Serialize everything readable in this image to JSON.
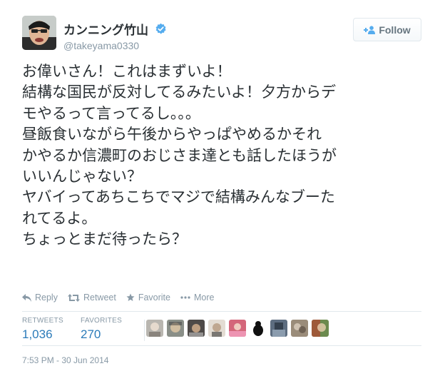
{
  "user": {
    "display_name": "カンニング竹山",
    "handle": "@takeyama0330",
    "verified": true
  },
  "follow_button": {
    "label": "Follow"
  },
  "tweet": {
    "lines": [
      "お偉いさん！これはまずいよ！",
      "結構な国民が反対してるみたいよ！夕方からデ",
      "モやるって言ってるし。。。",
      "昼飯食いながら午後からやっぱやめるかそれ",
      "かやるか信濃町のおじさま達とも話したほうが",
      "いいんじゃない？",
      "ヤバイってあちこちでマジで結構みんなブーた",
      "れてるよ。",
      "ちょっとまだ待ったら？"
    ]
  },
  "actions": {
    "reply": "Reply",
    "retweet": "Retweet",
    "favorite": "Favorite",
    "more": "More"
  },
  "stats": {
    "retweets_label": "RETWEETS",
    "retweets_value": "1,036",
    "favorites_label": "FAVORITES",
    "favorites_value": "270"
  },
  "favoriter_avatars": [
    {
      "color": "#b9b6b0"
    },
    {
      "color": "#8a8f88"
    },
    {
      "color": "#4e4a48"
    },
    {
      "color": "#e3dcd3"
    },
    {
      "color": "#d4667a"
    },
    {
      "color": "#1d1d1d"
    },
    {
      "color": "#5d6d80"
    },
    {
      "color": "#9a8c7a"
    },
    {
      "color": "#6b8a4e"
    }
  ],
  "timestamp": "7:53 PM - 30 Jun 2014",
  "colors": {
    "link": "#2b7bb9",
    "muted": "#8899a6",
    "text": "#292f33",
    "border": "#e1e8ed",
    "verified": "#55acee"
  }
}
